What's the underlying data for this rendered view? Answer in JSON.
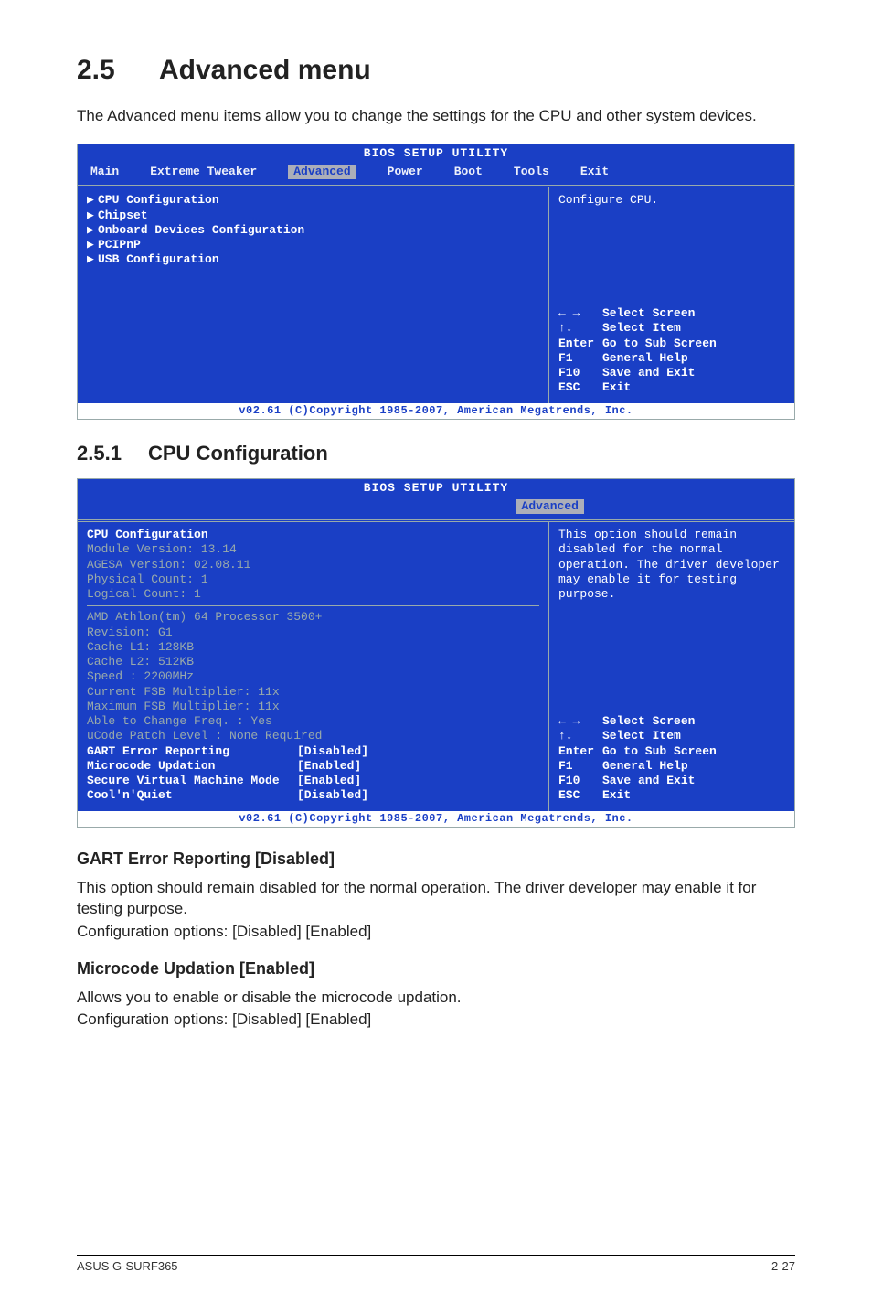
{
  "section": {
    "number": "2.5",
    "title": "Advanced menu"
  },
  "intro": "The Advanced menu items allow you to change the settings for the CPU and other system devices.",
  "bios1": {
    "title": "BIOS SETUP UTILITY",
    "menu": [
      "Main",
      "Extreme Tweaker",
      "Advanced",
      "Power",
      "Boot",
      "Tools",
      "Exit"
    ],
    "selected": "Advanced",
    "left_items": [
      "CPU Configuration",
      "Chipset",
      "Onboard Devices Configuration",
      "PCIPnP",
      "USB Configuration"
    ],
    "help_top": "Configure CPU.",
    "help_keys": [
      {
        "k": "← →",
        "v": "Select Screen"
      },
      {
        "k": "↑↓",
        "v": "Select Item"
      },
      {
        "k": "Enter",
        "v": "Go to Sub Screen"
      },
      {
        "k": "F1",
        "v": "General Help"
      },
      {
        "k": "F10",
        "v": "Save and Exit"
      },
      {
        "k": "ESC",
        "v": "Exit"
      }
    ],
    "footer": "v02.61 (C)Copyright 1985-2007, American Megatrends, Inc."
  },
  "sub": {
    "number": "2.5.1",
    "title": "CPU Configuration"
  },
  "bios2": {
    "title": "BIOS SETUP UTILITY",
    "menu_selected": "Advanced",
    "header": "CPU Configuration",
    "info_block": [
      "Module Version: 13.14",
      "AGESA Version: 02.08.11",
      "Physical Count: 1",
      "Logical Count: 1"
    ],
    "cpu_block": [
      "AMD Athlon(tm) 64 Processor 3500+",
      "Revision: G1",
      "Cache L1: 128KB",
      "Cache L2: 512KB",
      "Speed   : 2200MHz",
      "Current FSB Multiplier: 11x",
      "Maximum FSB Multiplier: 11x",
      "Able to Change Freq.  : Yes",
      "uCode Patch Level     : None Required"
    ],
    "settings": [
      {
        "k": "GART Error Reporting",
        "v": "[Disabled]"
      },
      {
        "k": "Microcode Updation",
        "v": "[Enabled]"
      },
      {
        "k": "Secure Virtual Machine Mode",
        "v": "[Enabled]"
      },
      {
        "k": "Cool'n'Quiet",
        "v": "[Disabled]"
      }
    ],
    "help_top": "This option should remain disabled for the normal operation. The driver developer may enable it for testing purpose.",
    "help_keys": [
      {
        "k": "← →",
        "v": "Select Screen"
      },
      {
        "k": "↑↓",
        "v": "Select Item"
      },
      {
        "k": "Enter",
        "v": "Go to Sub Screen"
      },
      {
        "k": "F1",
        "v": "General Help"
      },
      {
        "k": "F10",
        "v": "Save and Exit"
      },
      {
        "k": "ESC",
        "v": "Exit"
      }
    ],
    "footer": "v02.61 (C)Copyright 1985-2007, American Megatrends, Inc."
  },
  "para1": {
    "heading": "GART Error Reporting [Disabled]",
    "body": "This option should remain disabled for the normal operation. The driver developer may enable it for testing purpose.",
    "opts": "Configuration options: [Disabled] [Enabled]"
  },
  "para2": {
    "heading": "Microcode Updation [Enabled]",
    "body": "Allows you to enable or disable the microcode updation.",
    "opts": "Configuration options: [Disabled] [Enabled]"
  },
  "footer": {
    "left": "ASUS G-SURF365",
    "right": "2-27"
  }
}
